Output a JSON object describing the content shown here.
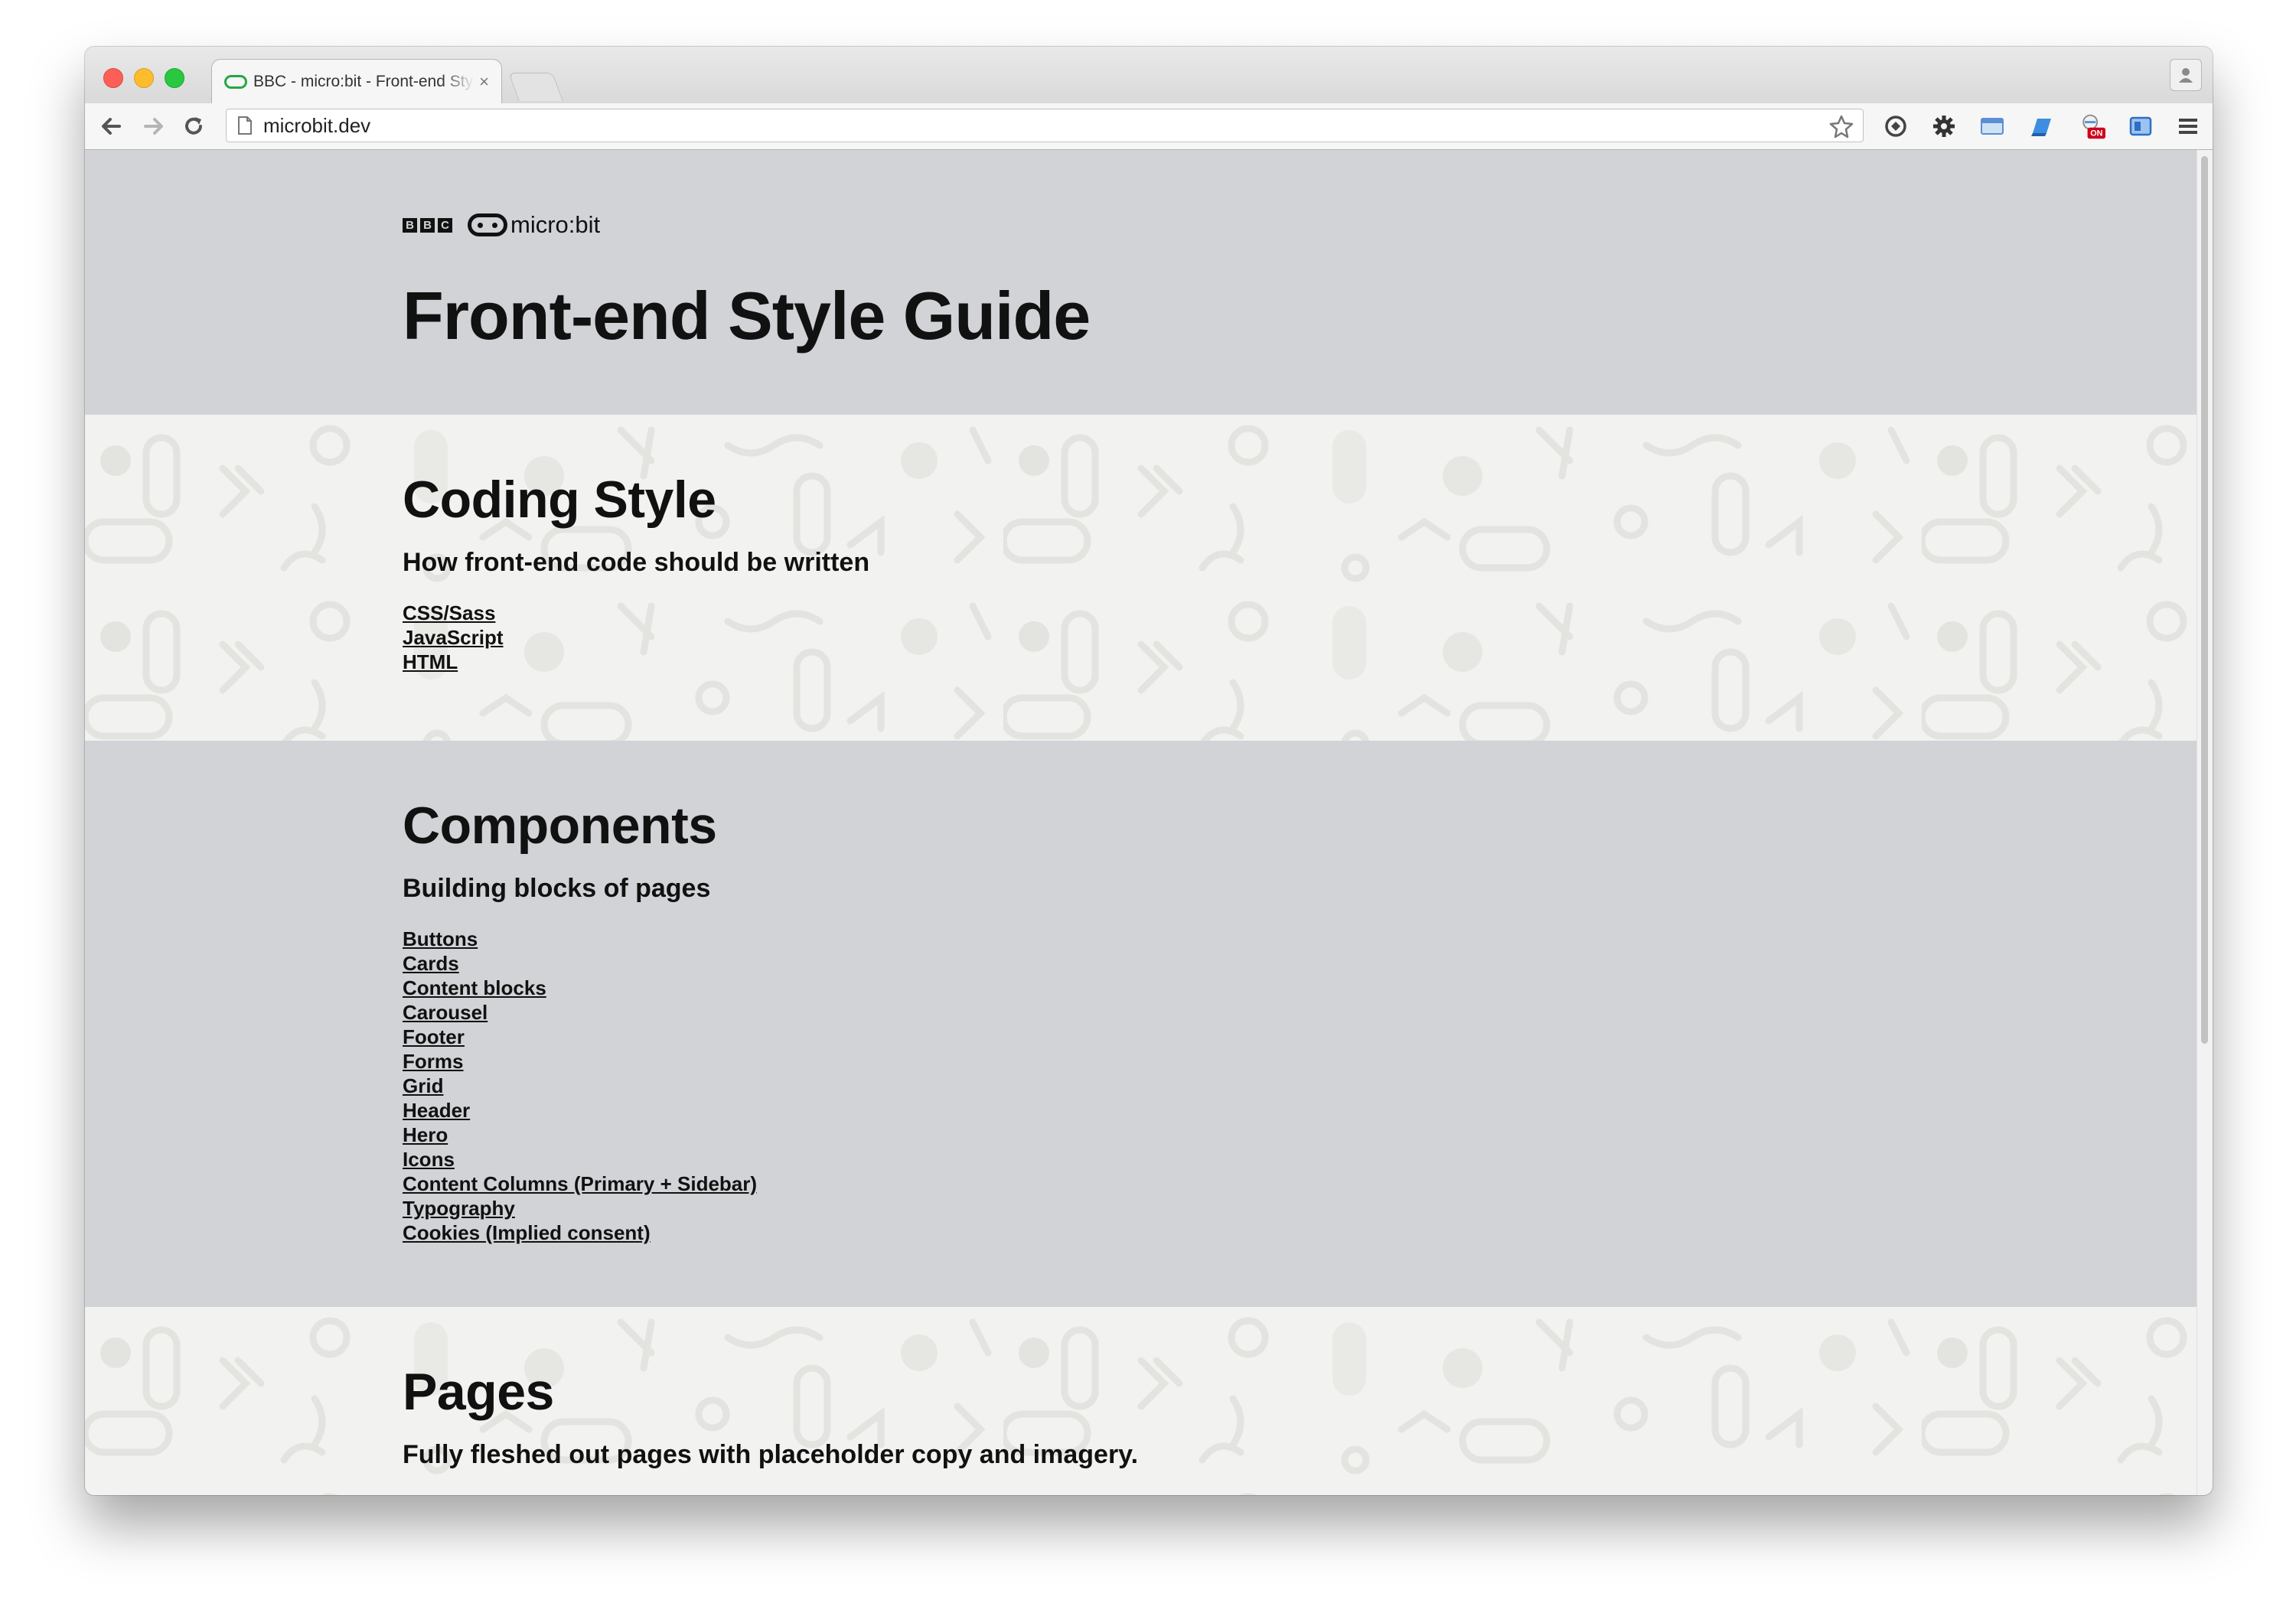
{
  "browser": {
    "tab_title": "BBC - micro:bit - Front-end Style Guide",
    "tab_close": "×",
    "url": "microbit.dev",
    "extension_badge": "ON"
  },
  "header": {
    "bbc_letters": [
      "B",
      "B",
      "C"
    ],
    "brand_name": "micro:bit",
    "title": "Front-end Style Guide"
  },
  "sections": [
    {
      "heading": "Coding Style",
      "subtitle": "How front-end code should be written",
      "links": [
        "CSS/Sass",
        "JavaScript",
        "HTML"
      ]
    },
    {
      "heading": "Components",
      "subtitle": "Building blocks of pages",
      "links": [
        "Buttons",
        "Cards",
        "Content blocks",
        "Carousel",
        "Footer",
        "Forms",
        "Grid",
        "Header",
        "Hero",
        "Icons",
        "Content Columns (Primary + Sidebar)",
        "Typography",
        "Cookies (Implied consent)"
      ]
    },
    {
      "heading": "Pages",
      "subtitle": "Fully fleshed out pages with placeholder copy and imagery."
    }
  ],
  "colors": {
    "header_bg": "#d1d3d6",
    "pattern_bg": "#f2f2f0",
    "text": "#111111",
    "tab_favicon": "#23a844"
  }
}
